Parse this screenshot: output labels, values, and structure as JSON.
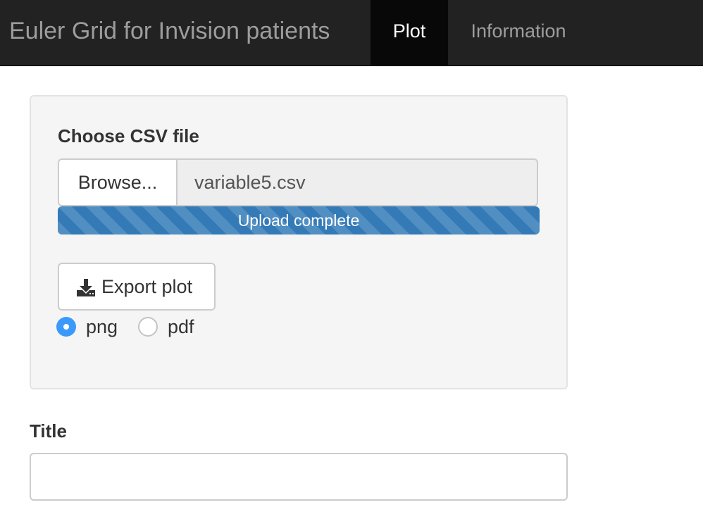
{
  "navbar": {
    "brand": "Euler Grid for Invision patients",
    "tabs": [
      {
        "label": "Plot",
        "active": true
      },
      {
        "label": "Information",
        "active": false
      }
    ]
  },
  "upload": {
    "label": "Choose CSV file",
    "browse_label": "Browse...",
    "file_name": "variable5.csv",
    "progress_text": "Upload complete",
    "progress": 1.0
  },
  "export": {
    "button_label": "Export plot",
    "icon": "download-icon",
    "formats": [
      {
        "label": "png",
        "selected": true
      },
      {
        "label": "pdf",
        "selected": false
      }
    ]
  },
  "title_field": {
    "label": "Title",
    "value": "",
    "placeholder": ""
  },
  "colors": {
    "navbar_bg": "#222222",
    "active_tab_bg": "#080808",
    "progress": "#337ab7",
    "radio_selected": "#3b99fc",
    "well_bg": "#f5f5f5"
  }
}
